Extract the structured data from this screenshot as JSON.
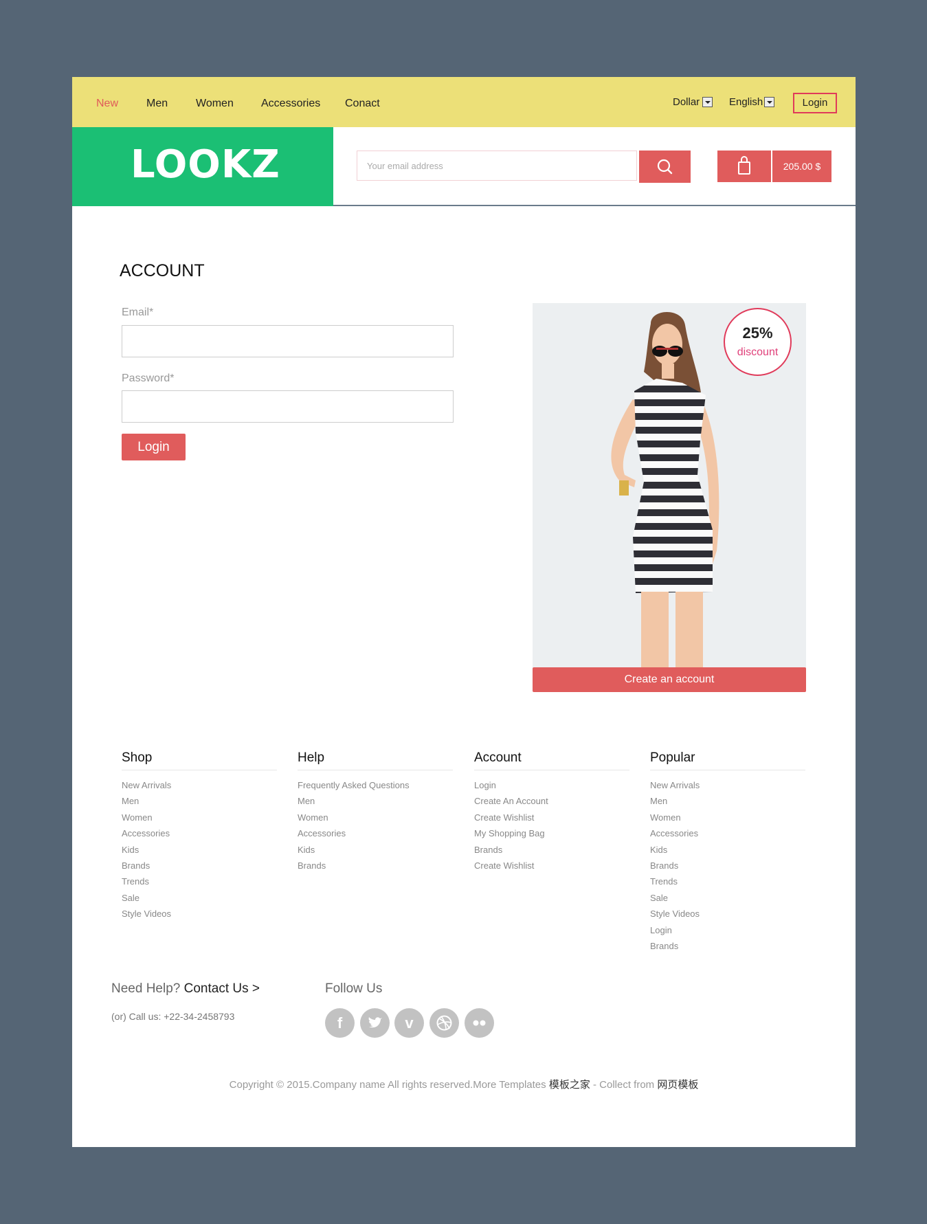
{
  "nav": {
    "items": [
      "New",
      "Men",
      "Women",
      "Accessories",
      "Conact"
    ],
    "currency": "Dollar",
    "language": "English",
    "login": "Login"
  },
  "header": {
    "logo": "LOOKZ",
    "email_placeholder": "Your email address",
    "cart_total": "205.00 $"
  },
  "account": {
    "title": "ACCOUNT",
    "email_label": "Email*",
    "password_label": "Password*",
    "login_button": "Login"
  },
  "promo": {
    "discount": "25%",
    "discount_label": "discount",
    "create_button": "Create an account"
  },
  "footer": {
    "columns": [
      {
        "title": "Shop",
        "links": [
          "New Arrivals",
          "Men",
          "Women",
          "Accessories",
          "Kids",
          "Brands",
          "Trends",
          "Sale",
          "Style Videos"
        ]
      },
      {
        "title": "Help",
        "links": [
          "Frequently Asked Questions",
          "Men",
          "Women",
          "Accessories",
          "Kids",
          "Brands"
        ]
      },
      {
        "title": "Account",
        "links": [
          "Login",
          "Create An Account",
          "Create Wishlist",
          "My Shopping Bag",
          "Brands",
          "Create Wishlist"
        ]
      },
      {
        "title": "Popular",
        "links": [
          "New Arrivals",
          "Men",
          "Women",
          "Accessories",
          "Kids",
          "Brands",
          "Trends",
          "Sale",
          "Style Videos",
          "Login",
          "Brands"
        ]
      }
    ],
    "need_help": "Need Help?",
    "contact_us": "Contact Us >",
    "call": "(or) Call us: +22-34-2458793",
    "follow_us": "Follow Us",
    "social_icons": [
      "facebook-icon",
      "twitter-icon",
      "vimeo-icon",
      "dribbble-icon",
      "flickr-icon"
    ],
    "copyright_text": "Copyright © 2015.Company name All rights reserved.More Templates",
    "copyright_link1": "模板之家",
    "copyright_mid": " - Collect from ",
    "copyright_link2": "网页模板"
  },
  "colors": {
    "background": "#556575",
    "topbar": "#ece078",
    "logo_green": "#1bbf74",
    "accent_red": "#e05c5c",
    "badge_pink": "#e03a5a"
  }
}
